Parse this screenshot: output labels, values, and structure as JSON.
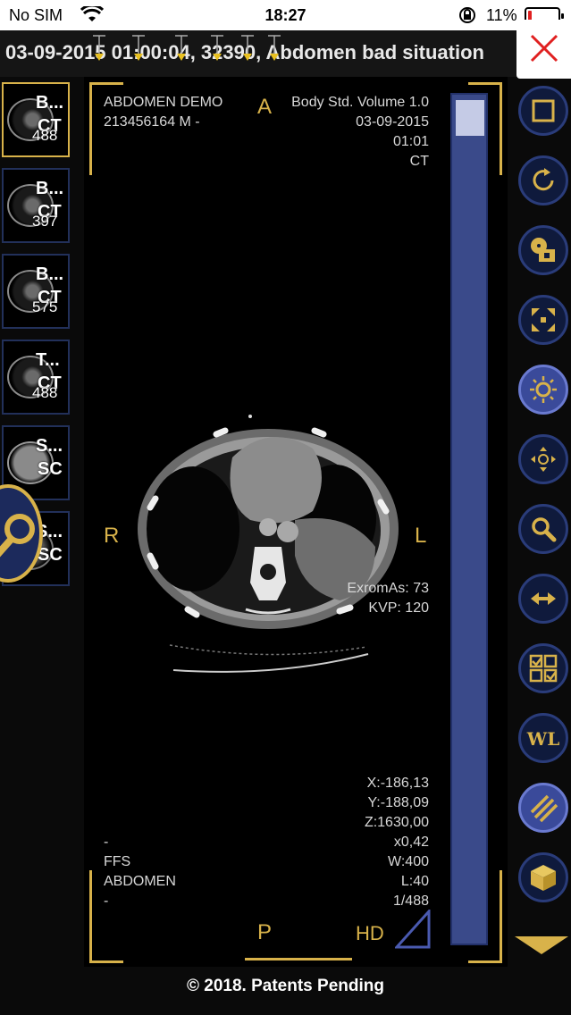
{
  "status_bar": {
    "carrier": "No SIM",
    "time": "18:27",
    "battery_percent": "11%",
    "battery_level": 0.11
  },
  "title_bar": {
    "text": "03-09-2015 01:00:04, 32390, Abdomen bad situation"
  },
  "thumbnails": [
    {
      "label1": "B...",
      "label2": "CT",
      "count": "488",
      "active": true
    },
    {
      "label1": "B...",
      "label2": "CT",
      "count": "397",
      "active": false
    },
    {
      "label1": "B...",
      "label2": "CT",
      "count": "575",
      "active": false
    },
    {
      "label1": "T...",
      "label2": "CT",
      "count": "488",
      "active": false
    },
    {
      "label1": "S...",
      "label2": "SC",
      "count": "",
      "active": false
    },
    {
      "label1": "S...",
      "label2": "SC",
      "count": "",
      "active": false
    }
  ],
  "viewer": {
    "top_left": [
      "ABDOMEN DEMO",
      "213456164 M -"
    ],
    "top_right": [
      "Body Std. Volume 1.0",
      "03-09-2015",
      "01:01",
      "CT"
    ],
    "orientation": {
      "top": "A",
      "bottom": "P",
      "left": "R",
      "right": "L"
    },
    "exposure": [
      "ExromAs: 73",
      "KVP: 120"
    ],
    "bottom_left": [
      "-",
      "FFS",
      "ABDOMEN",
      "-"
    ],
    "bottom_right": [
      "X:-186,13",
      "Y:-188,09",
      "Z:1630,00",
      "x0,42",
      "W:400",
      "L:40",
      "1/488"
    ],
    "hd_label": "HD"
  },
  "toolbar": {
    "tools": [
      {
        "name": "square-select-tool"
      },
      {
        "name": "rotate-tool"
      },
      {
        "name": "cd-export-tool"
      },
      {
        "name": "fullscreen-tool"
      },
      {
        "name": "brightness-tool",
        "active": true
      },
      {
        "name": "pan-tool"
      },
      {
        "name": "zoom-tool"
      },
      {
        "name": "flip-tool"
      },
      {
        "name": "checklist-tool"
      },
      {
        "name": "window-level-tool",
        "label": "WL"
      },
      {
        "name": "stripes-tool",
        "active": true
      },
      {
        "name": "3d-box-tool"
      }
    ]
  },
  "footer": {
    "text": "© 2018. Patents Pending"
  },
  "colors": {
    "accent_gold": "#d8b24a",
    "tool_blue": "#2a3c7a",
    "close_red": "#e02020"
  }
}
